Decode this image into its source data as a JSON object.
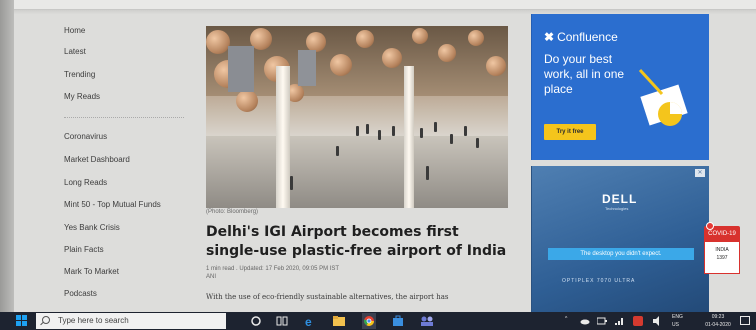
{
  "sidebar": {
    "items": [
      {
        "label": "Home"
      },
      {
        "label": "Latest"
      },
      {
        "label": "Trending"
      },
      {
        "label": "My Reads"
      },
      {
        "label": "Coronavirus"
      },
      {
        "label": "Market Dashboard"
      },
      {
        "label": "Long Reads"
      },
      {
        "label": "Mint 50 - Top Mutual Funds"
      },
      {
        "label": "Yes Bank Crisis"
      },
      {
        "label": "Plain Facts"
      },
      {
        "label": "Mark To Market"
      },
      {
        "label": "Podcasts"
      }
    ]
  },
  "article": {
    "photo_credit": "(Photo: Bloomberg)",
    "headline": "Delhi's IGI Airport becomes first single-use plastic-free airport of India",
    "meta": "1 min read . Updated: 17 Feb 2020, 09:05 PM IST",
    "source": "ANI",
    "summary": "With the use of eco-friendly sustainable alternatives, the airport has"
  },
  "ad_confluence": {
    "brand": "Confluence",
    "tagline": "Do your best work, all in one place",
    "cta": "Try it free",
    "colors": {
      "background": "#2b6ecf",
      "button": "#f4c51c"
    }
  },
  "ad_dell": {
    "brand": "DELL",
    "sub": "Technologies",
    "bar_text": "The desktop you didn't expect.",
    "footer": "OPTIPLEX 7070 ULTRA",
    "close_icon": "x-icon"
  },
  "covid_widget": {
    "title": "COVID-19",
    "country": "INDIA",
    "count": "1397",
    "color": "#d8322e"
  },
  "taskbar": {
    "search_placeholder": "Type here to search",
    "language": "ENG",
    "language_sub": "US",
    "time": "09:23",
    "date": "01-04-2020"
  }
}
